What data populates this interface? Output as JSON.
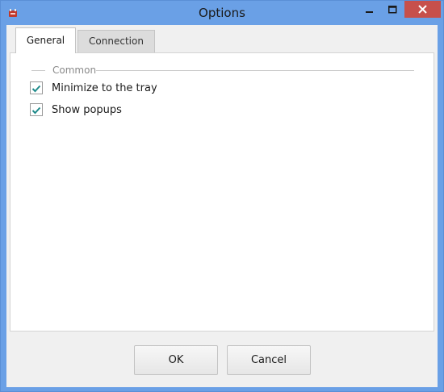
{
  "window": {
    "title": "Options",
    "app_icon": "app-logo-icon",
    "controls": [
      "minimize-icon",
      "maximize-icon",
      "close-icon"
    ]
  },
  "tabs": [
    {
      "label": "General",
      "selected": true
    },
    {
      "label": "Connection",
      "selected": false
    }
  ],
  "general": {
    "group_title": "Common",
    "options": [
      {
        "label": "Minimize to the tray",
        "checked": true
      },
      {
        "label": "Show popups",
        "checked": true
      }
    ]
  },
  "buttons": {
    "ok_label": "OK",
    "cancel_label": "Cancel"
  },
  "colors": {
    "title_bar": "#6aa0e6",
    "close_button": "#c7504b",
    "check_mark": "#1f8a8a"
  }
}
